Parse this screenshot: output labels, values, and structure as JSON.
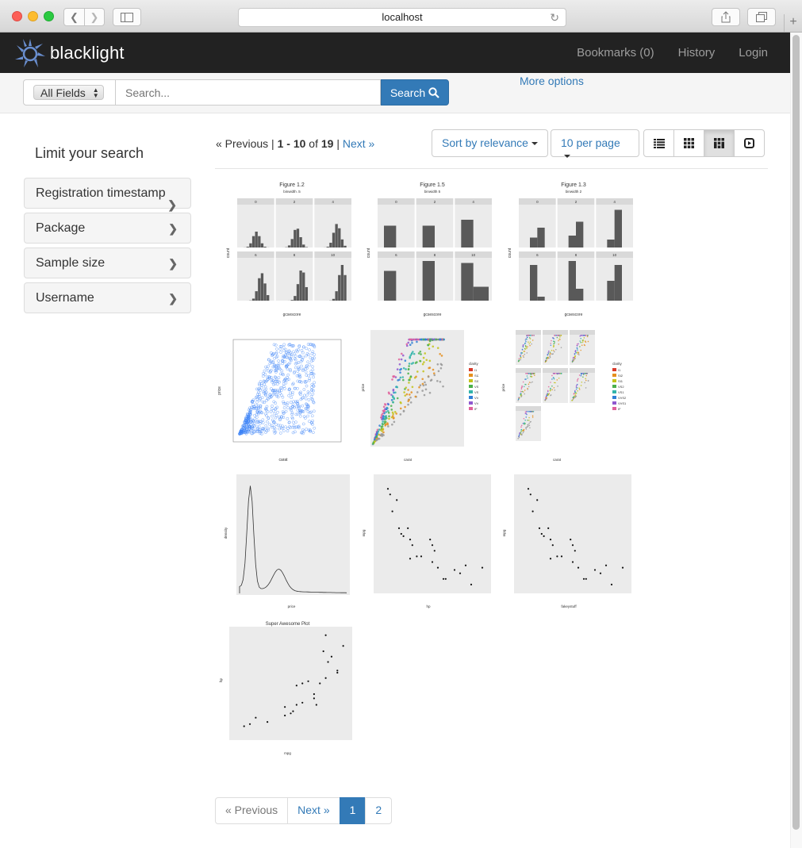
{
  "browser": {
    "address": "localhost"
  },
  "navbar": {
    "brand": "blacklight",
    "links": [
      "Bookmarks (0)",
      "History",
      "Login"
    ]
  },
  "search": {
    "field_select": "All Fields",
    "placeholder": "Search...",
    "button_label": "Search",
    "more_options": "More options"
  },
  "facets": {
    "title": "Limit your search",
    "items": [
      "Registration timestamp",
      "Package",
      "Sample size",
      "Username"
    ]
  },
  "results": {
    "prev": "« Previous",
    "sep": "|",
    "range_start": "1",
    "range_dash": " - ",
    "range_end": "10",
    "of": " of ",
    "total": "19",
    "next": "Next »",
    "sort_label": "Sort by relevance",
    "per_page_label": "10 per page",
    "view_modes": [
      "list",
      "gallery",
      "masonry",
      "slideshow"
    ],
    "active_view": "masonry"
  },
  "thumbnails": [
    {
      "title": "Figure 1.2",
      "subtitle": "binwidth .5",
      "panels": [
        "0",
        "2",
        "4",
        "6",
        "8",
        "10"
      ],
      "xlabel": "gcsescore",
      "ylabel": "count"
    },
    {
      "title": "Figure 1.5",
      "subtitle": "binwidth 5",
      "panels": [
        "0",
        "2",
        "4",
        "6",
        "8",
        "10"
      ],
      "xlabel": "gcsescore",
      "ylabel": "count"
    },
    {
      "title": "Figure 1.3",
      "subtitle": "binwidth 2",
      "panels": [
        "0",
        "2",
        "4",
        "6",
        "8",
        "10"
      ],
      "xlabel": "gcsescore",
      "ylabel": "count"
    },
    {
      "title": "",
      "xlabel": "carat",
      "ylabel": "price"
    },
    {
      "title": "",
      "xlabel": "carat",
      "ylabel": "price",
      "legend_title": "clarity",
      "legend": [
        "I1",
        "SI2",
        "SI1",
        "VS2",
        "VS1",
        "VVS2",
        "VVS1",
        "IF"
      ]
    },
    {
      "title": "",
      "xlabel": "carat",
      "ylabel": "price",
      "legend_title": "clarity",
      "legend": [
        "I1",
        "SI2",
        "SI1",
        "VS2",
        "VS1",
        "VVS2",
        "VVS1",
        "IF"
      ]
    },
    {
      "title": "",
      "xlabel": "price",
      "ylabel": "density"
    },
    {
      "title": "",
      "xlabel": "hp",
      "ylabel": "mpg"
    },
    {
      "title": "",
      "xlabel": "fakeystuff",
      "ylabel": "mpg"
    },
    {
      "title": "Super Awesome Plot",
      "xlabel": "mpg",
      "ylabel": "hp"
    }
  ],
  "pagination": {
    "prev": "« Previous",
    "next": "Next »",
    "pages": [
      "1",
      "2"
    ],
    "current": "1"
  },
  "colors": {
    "navbar_bg": "#222222",
    "link": "#337ab7",
    "primary": "#337ab7"
  }
}
